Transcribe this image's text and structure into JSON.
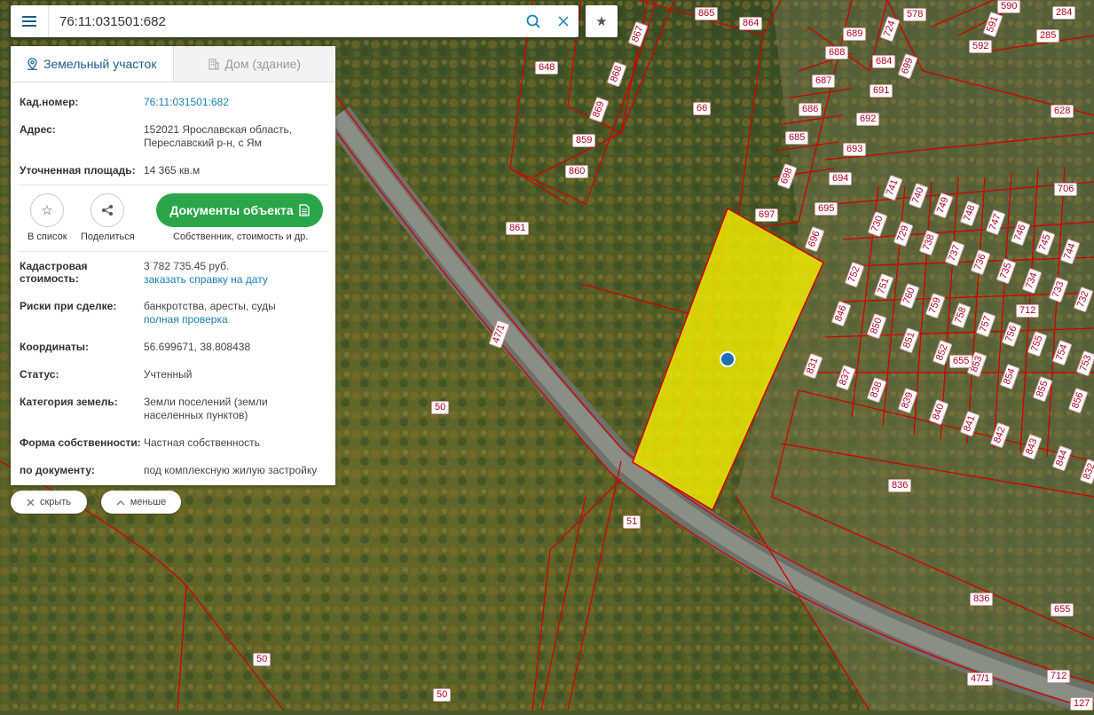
{
  "search": {
    "value": "76:11:031501:682"
  },
  "tabs": [
    {
      "label": "Земельный участок"
    },
    {
      "label": "Дом (здание)"
    }
  ],
  "info": {
    "cad_label": "Кад.номер:",
    "cad_value": "76:11:031501:682",
    "addr_label": "Адрес:",
    "addr_line1": "152021 Ярославская область,",
    "addr_line2": "Переславский р-н, с Ям",
    "area_label": "Уточненная площадь:",
    "area_value": "14 365 кв.м"
  },
  "actions": {
    "save_label": "В список",
    "share_label": "Поделиться",
    "docs_label": "Документы объекта",
    "docs_sub": "Собственник, стоимость и др."
  },
  "details": {
    "cost_label_1": "Кадастровая",
    "cost_label_2": "стоимость:",
    "cost_value": "3 782 735.45 руб.",
    "cost_link": "заказать справку на дату",
    "risk_label": "Риски при сделке:",
    "risk_value": "банкротства, аресты, суды",
    "risk_link": "полная проверка",
    "coord_label": "Координаты:",
    "coord_value": "56.699671, 38.808438",
    "status_label": "Статус:",
    "status_value": "Учтенный",
    "cat_label": "Категория земель:",
    "cat_line1": "Земли поселений (земли",
    "cat_line2": "населенных пунктов)",
    "own_label": "Форма собственности:",
    "own_value": "Частная собственность",
    "doc_label": "по документу:",
    "doc_value": "под комплексную жилую застройку"
  },
  "buttons": {
    "hide_label": "скрыть",
    "less_label": "меньше"
  },
  "map_labels": [
    "865",
    "864",
    "578",
    "591",
    "284",
    "285",
    "590",
    "592",
    "689",
    "724",
    "688",
    "684",
    "699",
    "687",
    "691",
    "686",
    "692",
    "628",
    "648",
    "867",
    "868",
    "869",
    "859",
    "860",
    "66",
    "685",
    "693",
    "698",
    "694",
    "697",
    "695",
    "696",
    "706",
    "741",
    "740",
    "749",
    "748",
    "747",
    "746",
    "745",
    "744",
    "730",
    "729",
    "738",
    "737",
    "736",
    "735",
    "734",
    "733",
    "732",
    "861",
    "752",
    "751",
    "760",
    "759",
    "758",
    "757",
    "756",
    "755",
    "754",
    "753",
    "712",
    "846",
    "850",
    "851",
    "852",
    "853",
    "655",
    "854",
    "855",
    "856",
    "831",
    "837",
    "838",
    "839",
    "840",
    "841",
    "842",
    "843",
    "844",
    "832",
    "47/1",
    "50",
    "836",
    "51",
    "836",
    "655",
    "50",
    "50",
    "47/1",
    "712",
    "127"
  ],
  "colors": {
    "parcel_fill": "#f5f000",
    "parcel_line": "#d40000",
    "button_green": "#2aa54a",
    "link_blue": "#1a7fb5"
  }
}
